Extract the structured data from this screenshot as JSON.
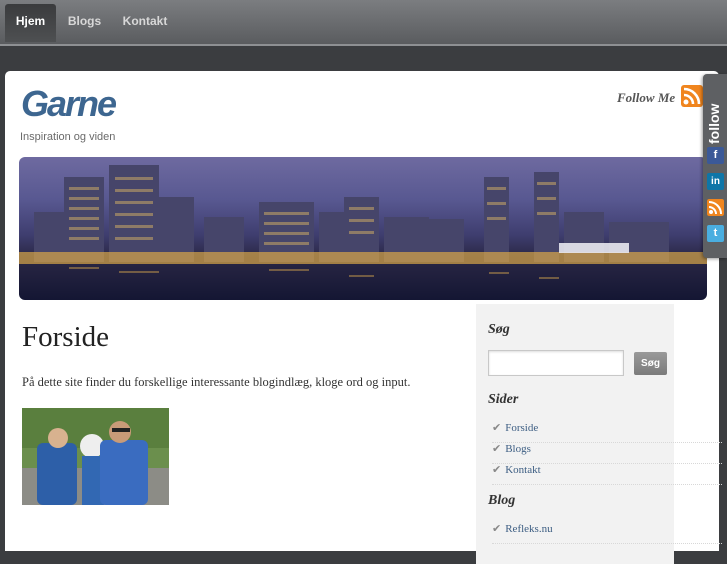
{
  "nav": {
    "items": [
      {
        "label": "Hjem"
      },
      {
        "label": "Blogs"
      },
      {
        "label": "Kontakt"
      }
    ]
  },
  "header": {
    "logo": "Garne",
    "tagline": "Inspiration og viden",
    "follow_text": "Follow Me"
  },
  "main": {
    "title": "Forside",
    "intro": "På dette site finder du forskellige interessante blogindlæg, kloge ord og input."
  },
  "sidebar": {
    "search_heading": "Søg",
    "search_button": "Søg",
    "search_value": "",
    "pages_heading": "Sider",
    "pages": [
      {
        "label": "Forside"
      },
      {
        "label": "Blogs"
      },
      {
        "label": "Kontakt"
      }
    ],
    "blog_heading": "Blog",
    "blogs": [
      {
        "label": "Refleks.nu"
      }
    ]
  },
  "follow_tab": {
    "label": "follow",
    "icons": [
      "facebook-icon",
      "linkedin-icon",
      "rss-icon",
      "twitter-icon"
    ]
  },
  "colors": {
    "accent": "#3d6690",
    "rss": "#f0851e",
    "facebook": "#3b5998",
    "linkedin": "#0e76a8",
    "twitter": "#4aaee0"
  }
}
